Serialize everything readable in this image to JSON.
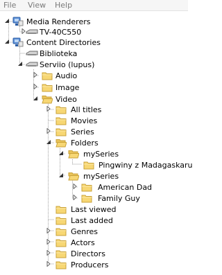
{
  "menu": {
    "file": "File",
    "view": "View",
    "help": "Help"
  },
  "tree": {
    "media_renderers": "Media Renderers",
    "tv": "TV-40C550",
    "content_directories": "Content Directories",
    "biblioteka": "Biblioteka",
    "serviio": "Serviio (lupus)",
    "audio": "Audio",
    "image": "Image",
    "video": "Video",
    "all_titles": "All titles",
    "movies": "Movies",
    "series": "Series",
    "folders": "Folders",
    "myseries_1": "mySeries",
    "pingwiny": "Pingwiny z Madagaskaru",
    "myseries_2": "mySeries",
    "american_dad": "American Dad",
    "family_guy": "Family Guy",
    "last_viewed": "Last viewed",
    "last_added": "Last added",
    "genres": "Genres",
    "actors": "Actors",
    "directors": "Directors",
    "producers": "Producers"
  },
  "icons": {
    "folder": "folder-icon",
    "open_folder": "folder-open-icon",
    "network": "network-icon",
    "device": "device-icon"
  },
  "colors": {
    "folder_fill": "#f7d774",
    "folder_edge": "#c9a238",
    "tree_line": "#a0a0a0",
    "menu_text": "#7a7a7a"
  }
}
